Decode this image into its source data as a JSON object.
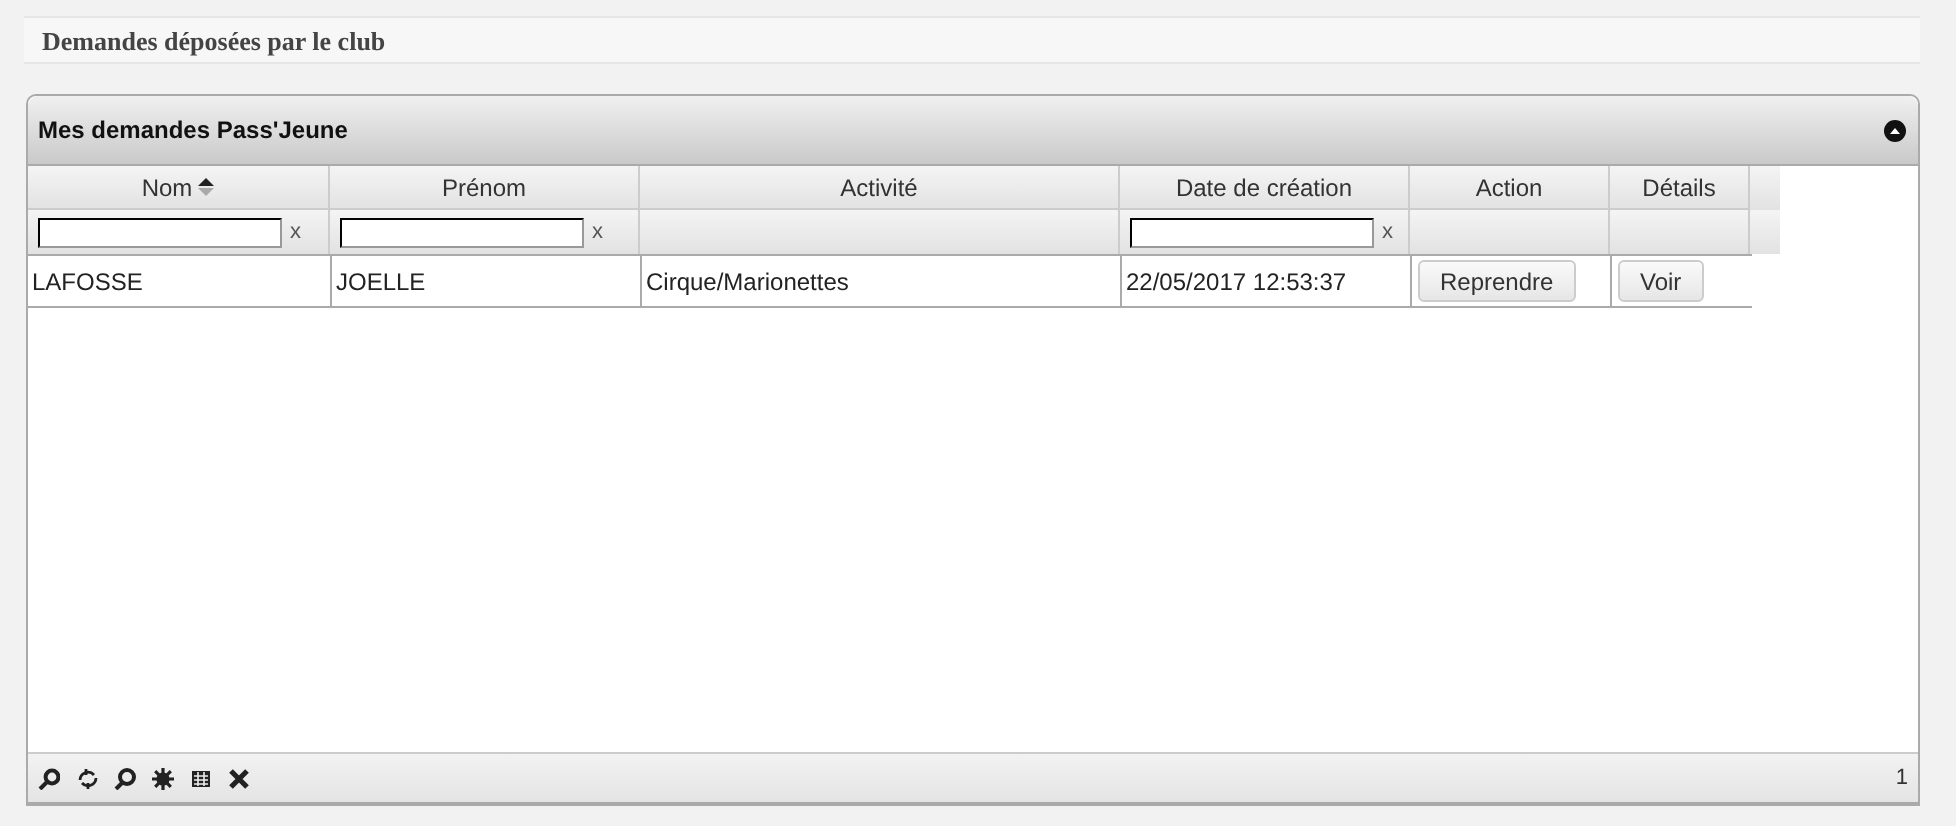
{
  "page_title": "Demandes déposées par le club",
  "panel": {
    "title": "Mes demandes Pass'Jeune",
    "expanded": true
  },
  "table": {
    "columns": [
      {
        "label": "Nom",
        "sorted": true,
        "filter_clear": "x"
      },
      {
        "label": "Prénom",
        "sorted": false,
        "filter_clear": "x"
      },
      {
        "label": "Activité",
        "sorted": false
      },
      {
        "label": "Date de création",
        "sorted": false,
        "filter_clear": "x"
      },
      {
        "label": "Action",
        "sorted": false
      },
      {
        "label": "Détails",
        "sorted": false
      }
    ],
    "rows": [
      {
        "cells": [
          {
            "kind": "text",
            "text": "LAFOSSE"
          },
          {
            "kind": "text",
            "text": "JOELLE"
          },
          {
            "kind": "text",
            "text": "Cirque/Marionettes"
          },
          {
            "kind": "text",
            "text": "22/05/2017 12:53:37"
          },
          {
            "kind": "button",
            "text": "Reprendre"
          },
          {
            "kind": "button",
            "text": "Voir"
          }
        ]
      }
    ]
  },
  "footer": {
    "tools": [
      {
        "kind": "search"
      },
      {
        "kind": "refresh"
      },
      {
        "kind": "find"
      },
      {
        "kind": "settings"
      },
      {
        "kind": "columns"
      },
      {
        "kind": "close"
      }
    ],
    "page": "1"
  }
}
